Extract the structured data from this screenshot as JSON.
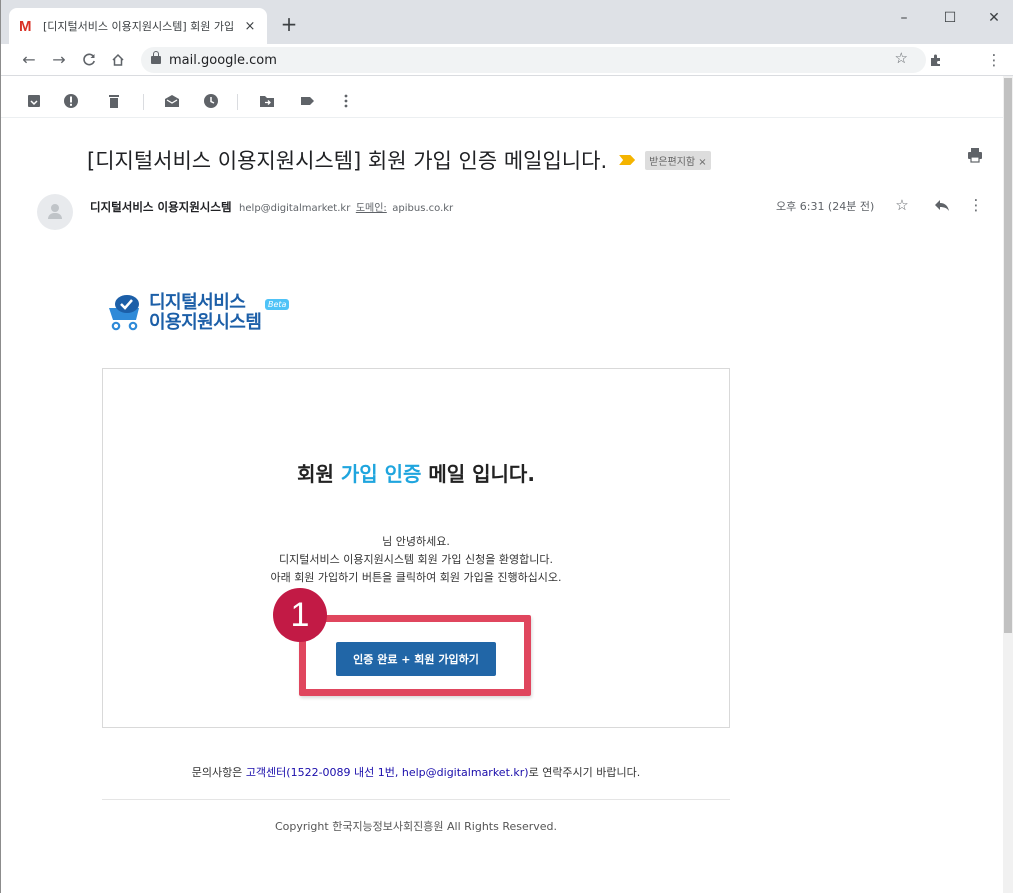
{
  "browser": {
    "tab_title": "[디지털서비스 이용지원시스템] 회원 가입 인증 메일입니다.",
    "tab_favicon": "M",
    "tab_close": "×",
    "new_tab": "+",
    "url": "mail.google.com",
    "window_controls": {
      "minimize": "–",
      "maximize": "☐",
      "close": "✕"
    }
  },
  "email": {
    "subject": "[디지털서비스 이용지원시스템] 회원 가입 인증 메일입니다.",
    "label": "받은편지함 ×",
    "sender_name": "디지털서비스 이용지원시스템",
    "sender_email": "help@digitalmarket.kr",
    "domain_label": "도메인:",
    "domain_value": "apibus.co.kr",
    "timestamp": "오후 6:31 (24분 전)"
  },
  "body": {
    "logo_line1": "디지털서비스",
    "logo_line2": "이용지원시스템",
    "logo_badge": "Beta",
    "title_part1": "회원 ",
    "title_highlight": "가입 인증",
    "title_part2": " 메일 입니다.",
    "greeting": "님 안녕하세요.",
    "welcome": "디지털서비스 이용지원시스템 회원 가입 신청을 환영합니다.",
    "instruction": "아래 회원 가입하기 버튼을 클릭하여 회원 가입을 진행하십시오.",
    "cta_label": "인증 완료 + 회원 가입하기",
    "step_number": "1",
    "footer_prefix": "문의사항은 ",
    "footer_link": "고객센터(1522-0089 내선 1번, help@digitalmarket.kr)",
    "footer_suffix": "로 연락주시기 바랍니다.",
    "copyright": "Copyright 한국지능정보사회진흥원 All Rights Reserved."
  },
  "colors": {
    "accent": "#1fa5de",
    "button": "#2166a7",
    "highlight": "#e0465e",
    "badge": "#c21a45"
  }
}
